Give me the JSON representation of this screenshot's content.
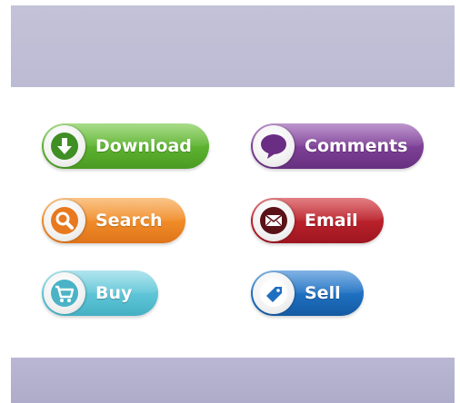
{
  "buttons": {
    "download": {
      "label": "Download",
      "icon": "download-arrow-icon",
      "color": "#5bb12f"
    },
    "comments": {
      "label": "Comments",
      "icon": "speech-bubble-icon",
      "color": "#7c3f95"
    },
    "search": {
      "label": "Search",
      "icon": "magnifier-icon",
      "color": "#f08a27"
    },
    "email": {
      "label": "Email",
      "icon": "envelope-icon",
      "color": "#b8202a"
    },
    "buy": {
      "label": "Buy",
      "icon": "shopping-cart-icon",
      "color": "#5cc4d6"
    },
    "sell": {
      "label": "Sell",
      "icon": "price-tag-icon",
      "color": "#1e6fc0"
    }
  }
}
